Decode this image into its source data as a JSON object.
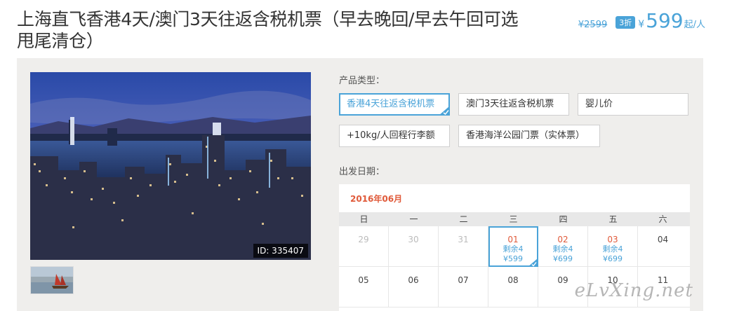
{
  "product": {
    "title": "上海直飞香港4天/澳门3天往返含税机票（早去晚回/早去午回可选 甩尾清仓）",
    "original_price": "¥2599",
    "discount": "3折",
    "currency": "¥",
    "price": "599",
    "price_unit": "起/人"
  },
  "gallery": {
    "image_id": "ID: 335407"
  },
  "options": {
    "type_label": "产品类型：",
    "items": [
      {
        "label": "香港4天往返含税机票",
        "selected": true
      },
      {
        "label": "澳门3天往返含税机票",
        "selected": false
      },
      {
        "label": "婴儿价",
        "selected": false
      },
      {
        "label": "+10kg/人回程行李额",
        "selected": false
      },
      {
        "label": "香港海洋公园门票（实体票）",
        "selected": false
      }
    ],
    "date_label": "出发日期："
  },
  "calendar": {
    "month": "2016年06月",
    "weekdays": [
      "日",
      "一",
      "二",
      "三",
      "四",
      "五",
      "六"
    ],
    "rows": [
      [
        {
          "day": "29",
          "state": "past"
        },
        {
          "day": "30",
          "state": "past"
        },
        {
          "day": "31",
          "state": "past"
        },
        {
          "day": "01",
          "state": "avail",
          "remain": "剩余4",
          "price": "¥599",
          "selected": true
        },
        {
          "day": "02",
          "state": "avail",
          "remain": "剩余4",
          "price": "¥699"
        },
        {
          "day": "03",
          "state": "avail",
          "remain": "剩余4",
          "price": "¥699"
        },
        {
          "day": "04",
          "state": "normal"
        }
      ],
      [
        {
          "day": "05",
          "state": "normal"
        },
        {
          "day": "06",
          "state": "normal"
        },
        {
          "day": "07",
          "state": "normal"
        },
        {
          "day": "08",
          "state": "normal"
        },
        {
          "day": "09",
          "state": "normal"
        },
        {
          "day": "10",
          "state": "normal"
        },
        {
          "day": "11",
          "state": "normal"
        }
      ]
    ]
  },
  "watermark": "eLvXing.net",
  "colors": {
    "accent": "#4aa3d8",
    "date_red": "#e05a3a",
    "panel_bg": "#efeeec"
  }
}
